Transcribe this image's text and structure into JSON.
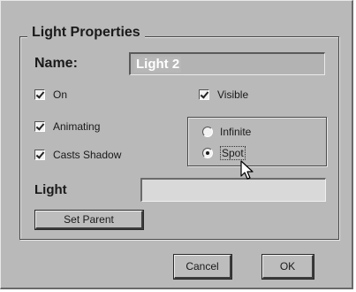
{
  "dialog": {
    "group_title": "Light Properties",
    "name_label": "Name:",
    "name_value": "Light 2",
    "checkboxes": {
      "on": {
        "label": "On",
        "checked": true
      },
      "animating": {
        "label": "Animating",
        "checked": true
      },
      "casts_shadow": {
        "label": "Casts Shadow",
        "checked": true
      },
      "visible": {
        "label": "Visible",
        "checked": true
      }
    },
    "light_type": {
      "infinite": {
        "label": "Infinite",
        "selected": false
      },
      "spot": {
        "label": "Spot",
        "selected": true
      }
    },
    "light_label": "Light",
    "light_color": "#d9d9d9",
    "set_parent_label": "Set Parent",
    "cancel_label": "Cancel",
    "ok_label": "OK"
  },
  "icons": {
    "cursor": "arrow-cursor-icon"
  }
}
